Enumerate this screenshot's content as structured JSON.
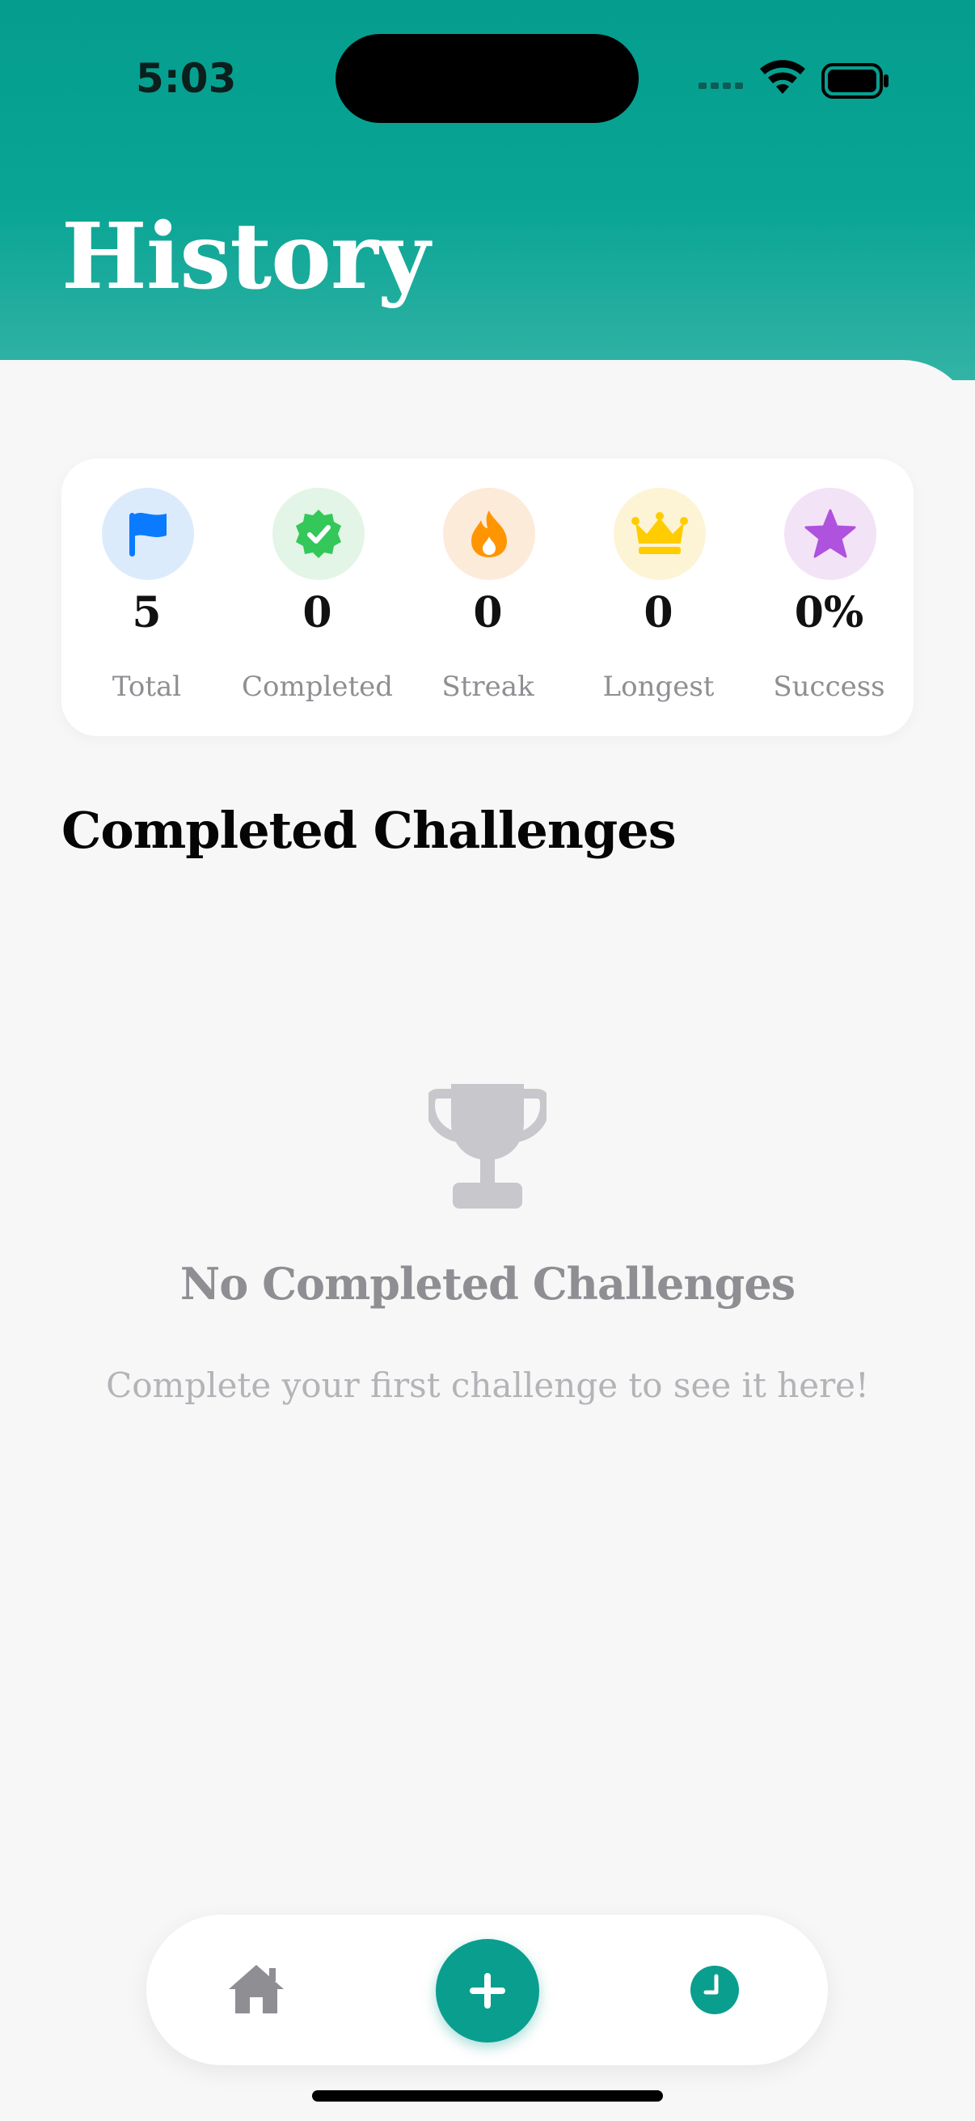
{
  "status_bar": {
    "time": "5:03"
  },
  "header": {
    "title": "History"
  },
  "stats": [
    {
      "icon": "flag-icon",
      "value": "5",
      "label": "Total",
      "bg": "#dcebfb",
      "color": "#0a7aff"
    },
    {
      "icon": "verified-check-icon",
      "value": "0",
      "label": "Completed",
      "bg": "#e2f5e6",
      "color": "#34c759"
    },
    {
      "icon": "flame-icon",
      "value": "0",
      "label": "Streak",
      "bg": "#fdebd9",
      "color": "#ff9500"
    },
    {
      "icon": "crown-icon",
      "value": "0",
      "label": "Longest",
      "bg": "#fdf4d6",
      "color": "#ffcc00"
    },
    {
      "icon": "star-icon",
      "value": "0%",
      "label": "Success",
      "bg": "#f3e3f7",
      "color": "#af52de"
    }
  ],
  "section": {
    "title": "Completed Challenges"
  },
  "empty_state": {
    "icon": "trophy-icon",
    "title": "No Completed Challenges",
    "subtitle": "Complete your first challenge to see it here!"
  },
  "tab_bar": {
    "items": [
      {
        "icon": "home-icon",
        "active": false
      },
      {
        "icon": "plus-icon",
        "active": false
      },
      {
        "icon": "clock-icon",
        "active": true
      }
    ],
    "accent": "#0a9e8f"
  }
}
